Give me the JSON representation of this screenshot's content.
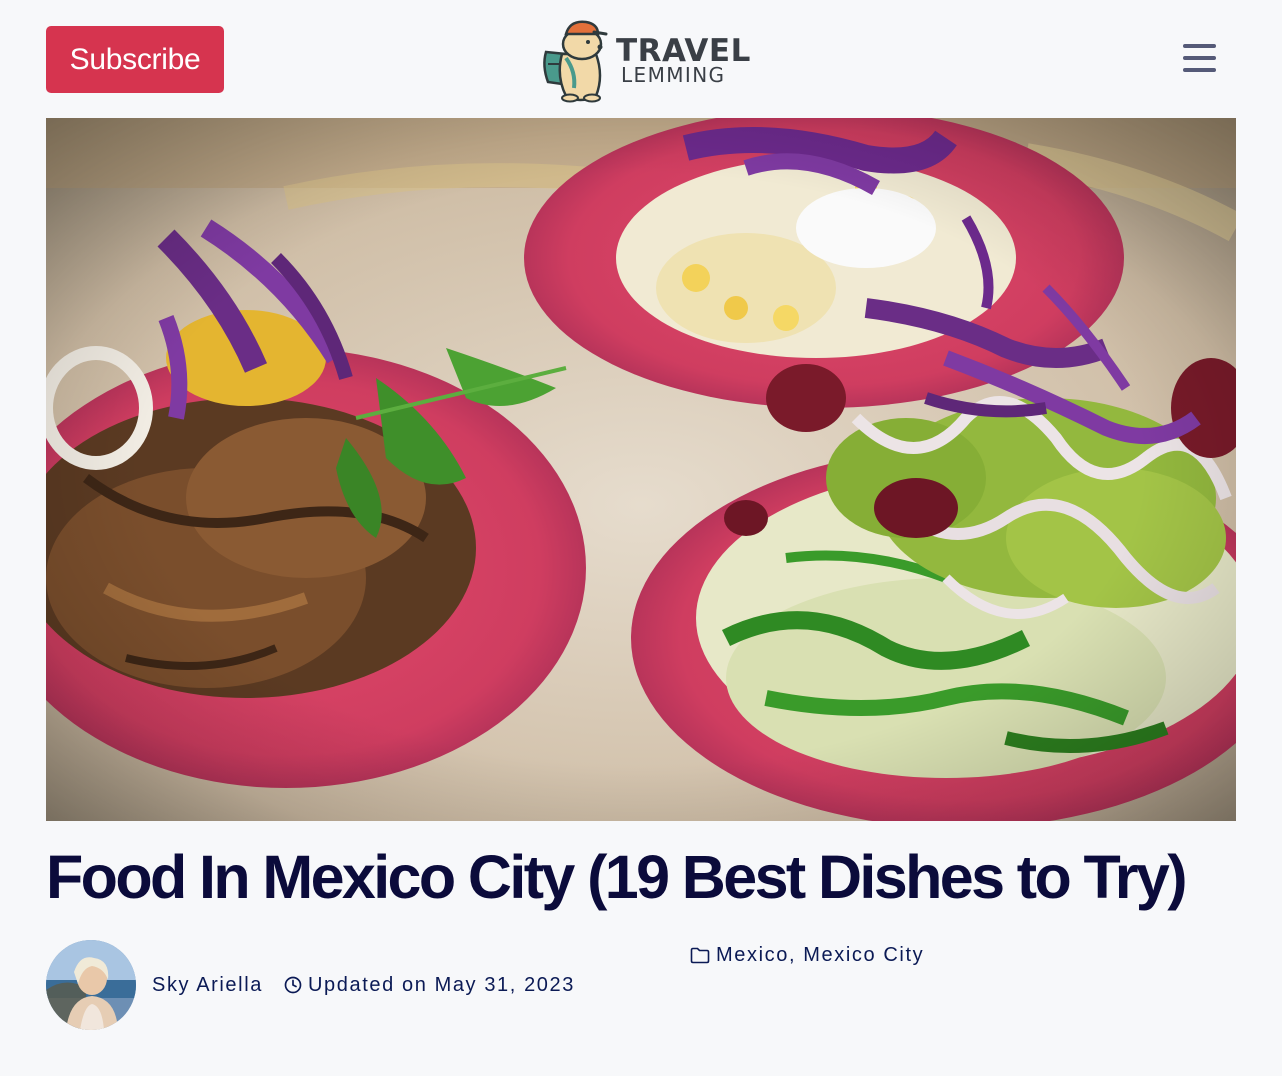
{
  "header": {
    "subscribe_label": "Subscribe",
    "logo": {
      "line1": "TRAVEL",
      "line2": "LEMMING",
      "icon": "lemming-backpacker-icon"
    },
    "menu_icon": "hamburger-menu-icon"
  },
  "hero": {
    "alt": "Colorful tacos on pink tortillas topped with red cabbage, guacamole and cranberries",
    "icon": "hero-image"
  },
  "article": {
    "title": "Food In Mexico City (19 Best Dishes to Try)",
    "author": "Sky Ariella",
    "updated": "Updated on May 31, 2023",
    "categories": [
      "Mexico",
      "Mexico City"
    ],
    "category_separator": ", "
  },
  "colors": {
    "subscribe_bg": "#d6344f",
    "title": "#0b0b3b",
    "meta_text": "#0b1a55",
    "menu_icon": "#555a78",
    "page_bg": "#f7f8fa"
  }
}
